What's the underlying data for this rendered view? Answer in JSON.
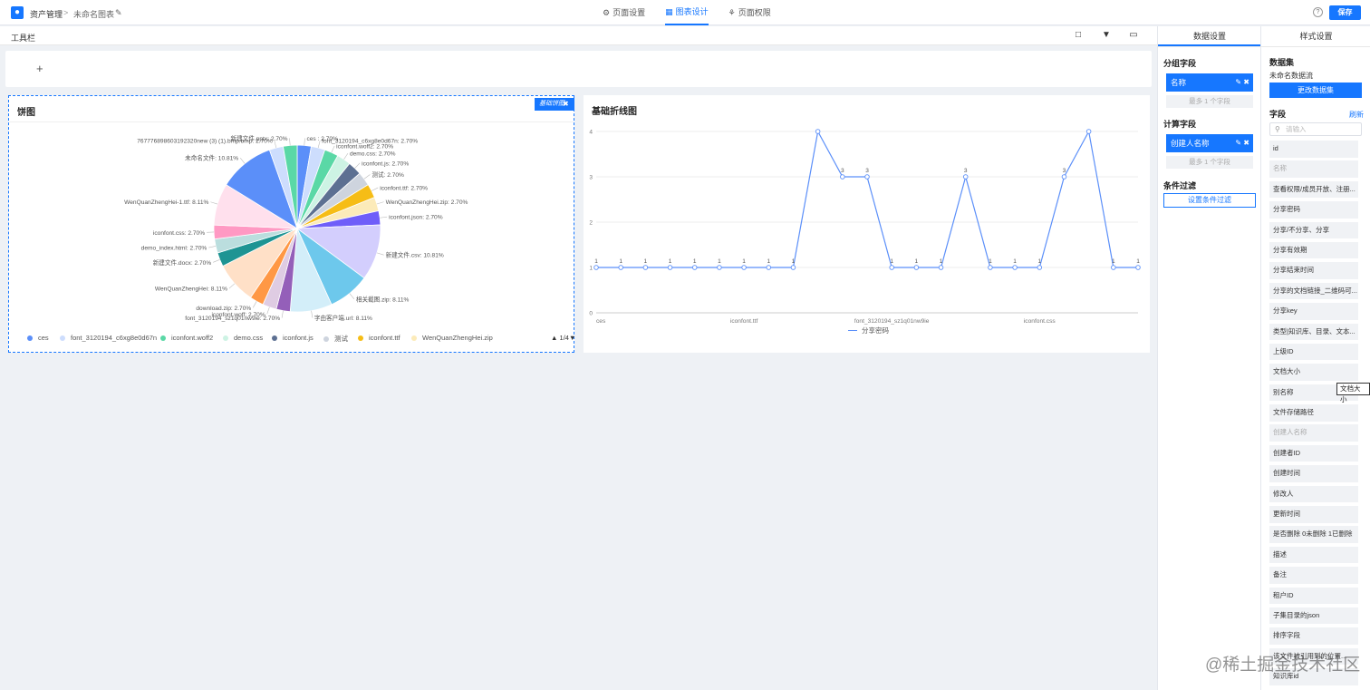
{
  "header": {
    "logo_icon": "person-icon",
    "breadcrumb_root": "资产管理",
    "breadcrumb_sep": ">",
    "breadcrumb_current": "未命名图表",
    "edit_icon": "pencil-icon",
    "tabs": [
      {
        "label": "页面设置",
        "icon": "gear-icon"
      },
      {
        "label": "图表设计",
        "icon": "chart-icon"
      },
      {
        "label": "页面权限",
        "icon": "lock-icon"
      }
    ],
    "help": "?",
    "save_label": "保存"
  },
  "toolbar": {
    "label": "工具栏",
    "icons": [
      "presentation-icon",
      "filter-icon",
      "monitor-icon"
    ]
  },
  "canvas": {
    "add_label": "+"
  },
  "pie_card": {
    "title": "饼图",
    "chip_label": "基础饼图",
    "chip_icon": "trash-icon",
    "legend": [
      "ces",
      "font_3120194_c6xg8e0d67n",
      "iconfont.woff2",
      "demo.css",
      "iconfont.js",
      "测试",
      "iconfont.ttf",
      "WenQuanZhengHei.zip"
    ],
    "pager": "1/4"
  },
  "line_card": {
    "title": "基础折线图",
    "legend": "分享密码"
  },
  "chart_data": [
    {
      "type": "pie",
      "title": "饼图",
      "slices": [
        {
          "name": "ces",
          "label": "ces : 2.70%",
          "percent": 2.7,
          "color": "#5b8ff9"
        },
        {
          "name": "font_3120194_c6xg8e0d67n",
          "label": "font_3120194_c6xg8e0d67n: 2.70%",
          "percent": 2.7,
          "color": "#cdddfd"
        },
        {
          "name": "iconfont.woff2",
          "label": "iconfont.woff2: 2.70%",
          "percent": 2.7,
          "color": "#5ad8a6"
        },
        {
          "name": "demo.css",
          "label": "demo.css: 2.70%",
          "percent": 2.7,
          "color": "#cdf3e4"
        },
        {
          "name": "iconfont.js",
          "label": "iconfont.js: 2.70%",
          "percent": 2.7,
          "color": "#5d7092"
        },
        {
          "name": "测试",
          "label": "测试: 2.70%",
          "percent": 2.7,
          "color": "#ced4de"
        },
        {
          "name": "iconfont.ttf",
          "label": "iconfont.ttf: 2.70%",
          "percent": 2.7,
          "color": "#f6bd16"
        },
        {
          "name": "WenQuanZhengHei.zip",
          "label": "WenQuanZhengHei.zip: 2.70%",
          "percent": 2.7,
          "color": "#fcebb9"
        },
        {
          "name": "iconfont.json",
          "label": "iconfont.json: 2.70%",
          "percent": 2.7,
          "color": "#6f5ef9"
        },
        {
          "name": "新建文件.csv",
          "label": "新建文件.csv: 10.81%",
          "percent": 10.81,
          "color": "#d3cefd"
        },
        {
          "name": "相关截图.zip",
          "label": "相关截图.zip: 8.11%",
          "percent": 8.11,
          "color": "#6dc8ec"
        },
        {
          "name": "字由客户端.url",
          "label": "字由客户端.url: 8.11%",
          "percent": 8.11,
          "color": "#d3eef9"
        },
        {
          "name": "font_3120194_sz1q01nw9ie",
          "label": "font_3120194_sz1q01nw9ie: 2.70%",
          "percent": 2.7,
          "color": "#945fb9"
        },
        {
          "name": "iconfont.woff",
          "label": "iconfont.woff: 2.70%",
          "percent": 2.7,
          "color": "#dfcce3"
        },
        {
          "name": "download.zip",
          "label": "download.zip: 2.70%",
          "percent": 2.7,
          "color": "#ff9845"
        },
        {
          "name": "WenQuanZhengHei",
          "label": "WenQuanZhengHei: 8.11%",
          "percent": 8.11,
          "color": "#ffe0c7"
        },
        {
          "name": "新建文件.docx",
          "label": "新建文件.docx: 2.70%",
          "percent": 2.7,
          "color": "#1e9493"
        },
        {
          "name": "demo_index.html",
          "label": "demo_index.html: 2.70%",
          "percent": 2.7,
          "color": "#bbdede"
        },
        {
          "name": "iconfont.css",
          "label": "iconfont.css: 2.70%",
          "percent": 2.7,
          "color": "#ff99c3"
        },
        {
          "name": "WenQuanZhengHei-1.ttf",
          "label": "WenQuanZhengHei-1.ttf: 8.11%",
          "percent": 8.11,
          "color": "#ffe0ed"
        },
        {
          "name": "未命名文件",
          "label": "未命名文件: 10.81%",
          "percent": 10.81,
          "color": "#5b8ff9"
        },
        {
          "name": "767776898603192320new (3) (1).bmp.bmp",
          "label": "767776898603192320new (3) (1).bmp.bmp: 2.70%",
          "percent": 2.7,
          "color": "#cdddfd"
        },
        {
          "name": "新建文件.pptx",
          "label": "新建文件.pptx: 2.70%",
          "percent": 2.7,
          "color": "#5ad8a6"
        }
      ]
    },
    {
      "type": "line",
      "title": "基础折线图",
      "series": [
        {
          "name": "分享密码",
          "values": [
            1,
            1,
            1,
            1,
            1,
            1,
            1,
            1,
            1,
            4,
            3,
            3,
            1,
            1,
            1,
            3,
            1,
            1,
            1,
            3,
            4,
            1,
            1
          ]
        }
      ],
      "x_tick_labels": [
        "ces",
        "iconfont.ttf",
        "font_3120194_sz1q01nw9ie",
        "iconfont.css"
      ],
      "y_ticks": [
        "0",
        "1",
        "2",
        "3",
        "4"
      ],
      "ylim": [
        0,
        4
      ],
      "data_labels": [
        "1",
        "1",
        "1",
        "1",
        "1",
        "1",
        "1",
        "1",
        "1",
        "",
        "3",
        "3",
        "1",
        "1",
        "1",
        "3",
        "1",
        "1",
        "1",
        "3",
        "",
        "1",
        "1"
      ],
      "color": "#5b8ff9",
      "grid": true
    }
  ],
  "group_panel": {
    "tab_data": "数据设置",
    "group_title": "分组字段",
    "group_field": "名称",
    "group_hint": "最多 1 个字段",
    "calc_title": "计算字段",
    "calc_field": "创建人名称",
    "calc_hint": "最多 1 个字段",
    "filter_title": "条件过滤",
    "filter_button": "设置条件过滤"
  },
  "field_panel": {
    "tab_style": "样式设置",
    "dataset_title": "数据集",
    "dataset_name": "未命名数据流",
    "change_button": "更改数据集",
    "fields_title": "字段",
    "refresh": "刷新",
    "search_placeholder": "请输入",
    "fields": [
      "id",
      "名称",
      "查看权限/成员开放、注册...",
      "分享密码",
      "分享/不分享、分享",
      "分享有效期",
      "分享结束时间",
      "分享的文档链接_二维码可...",
      "分享key",
      "类型|知识库、目录、文本...",
      "上级ID",
      "文档大小",
      "别名称",
      "文件存储路径",
      "创建人名称",
      "创建者ID",
      "创建时间",
      "修改人",
      "更新时间",
      "是否删除 0未删除 1已删除",
      "描述",
      "备注",
      "租户ID",
      "子集目录的json",
      "排序字段",
      "该文件被引用到的位置...",
      "知识库id"
    ],
    "dim_fields": [
      1,
      14
    ],
    "tooltip": "文档大小"
  },
  "watermark": "@稀土掘金技术社区"
}
